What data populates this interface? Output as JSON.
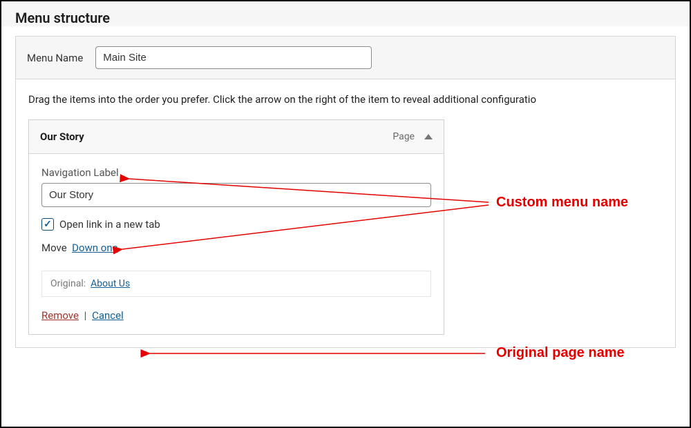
{
  "section_title": "Menu structure",
  "menu_name": {
    "label": "Menu Name",
    "value": "Main Site"
  },
  "instruction_text": "Drag the items into the order you prefer. Click the arrow on the right of the item to reveal additional configuratio",
  "menu_item": {
    "title": "Our Story",
    "type": "Page",
    "nav_label_label": "Navigation Label",
    "nav_label_value": "Our Story",
    "new_tab_label": "Open link in a new tab",
    "new_tab_checked": true,
    "move_label": "Move",
    "move_down_one": "Down one",
    "original_label": "Original:",
    "original_link": "About Us",
    "remove_label": "Remove",
    "cancel_label": "Cancel"
  },
  "annotations": {
    "custom_menu_name": "Custom menu name",
    "original_page_name": "Original page name"
  }
}
